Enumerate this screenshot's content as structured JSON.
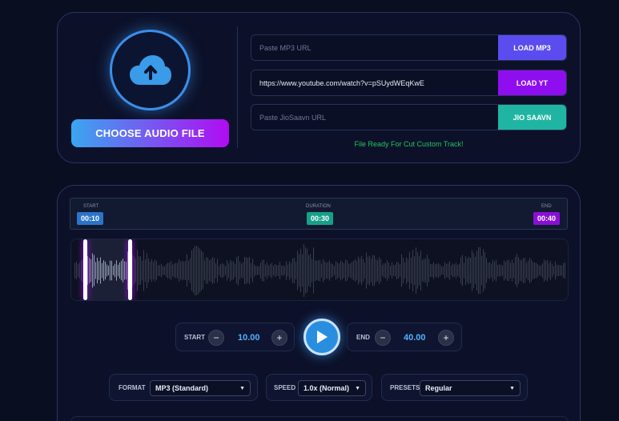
{
  "upload": {
    "icon": "cloud-upload-icon",
    "choose_label": "CHOOSE AUDIO FILE"
  },
  "sources": {
    "mp3": {
      "placeholder": "Paste MP3 URL",
      "value": "",
      "button": "LOAD MP3",
      "color": "#5b4cf0"
    },
    "yt": {
      "placeholder": "",
      "value": "https://www.youtube.com/watch?v=pSUydWEqKwE",
      "button": "LOAD YT",
      "color": "#8f0ef0"
    },
    "jio": {
      "placeholder": "Paste JioSaavn URL",
      "value": "",
      "button": "JIO SAAVN",
      "color": "#1fb5a2"
    }
  },
  "status": "File Ready For Cut Custom Track!",
  "timeline": {
    "start_label": "START",
    "start_value": "00:10",
    "start_color": "#2b74c9",
    "duration_label": "DURATION",
    "duration_value": "00:30",
    "duration_color": "#17a089",
    "end_label": "END",
    "end_value": "00:40",
    "end_color": "#8a0fd6"
  },
  "controls": {
    "start_label": "START",
    "start_value": "10.00",
    "end_label": "END",
    "end_value": "40.00",
    "minus": "−",
    "plus": "+"
  },
  "options": {
    "format_label": "FORMAT",
    "format_value": "MP3 (Standard)",
    "speed_label": "SPEED",
    "speed_value": "1.0x (Normal)",
    "presets_label": "PRESETS",
    "presets_value": "Regular"
  },
  "colors": {
    "accent": "#3a8eea",
    "purple": "#b00cf2",
    "status": "#22c55e"
  }
}
